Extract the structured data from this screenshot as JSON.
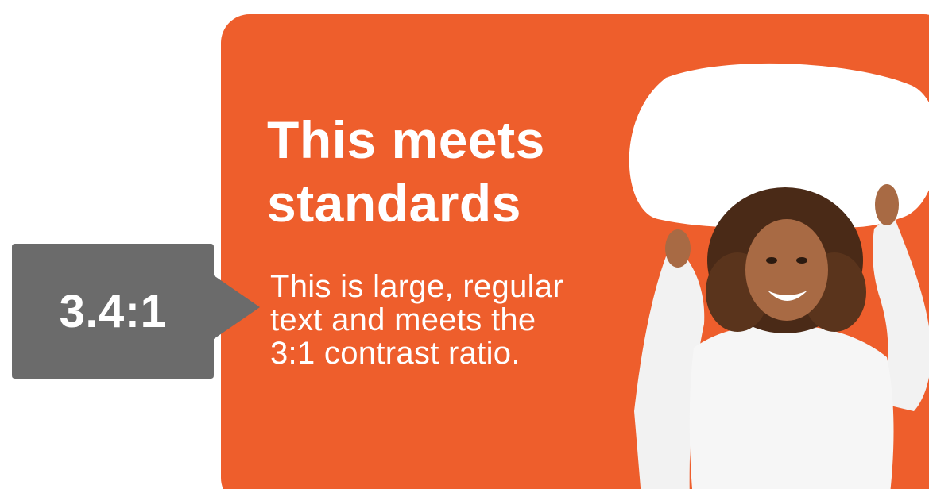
{
  "card": {
    "headline_line1": "This meets",
    "headline_line2": "standards",
    "body_line1": "This is large, regular",
    "body_line2": "text and meets the",
    "body_line3": "3:1 contrast ratio.",
    "background_color": "#EE5E2C",
    "text_color": "#FFFFFF"
  },
  "callout": {
    "ratio_label": "3.4:1",
    "background_color": "#6B6B6B"
  },
  "photo": {
    "icon": "woman-holding-speech-bubble-icon"
  }
}
